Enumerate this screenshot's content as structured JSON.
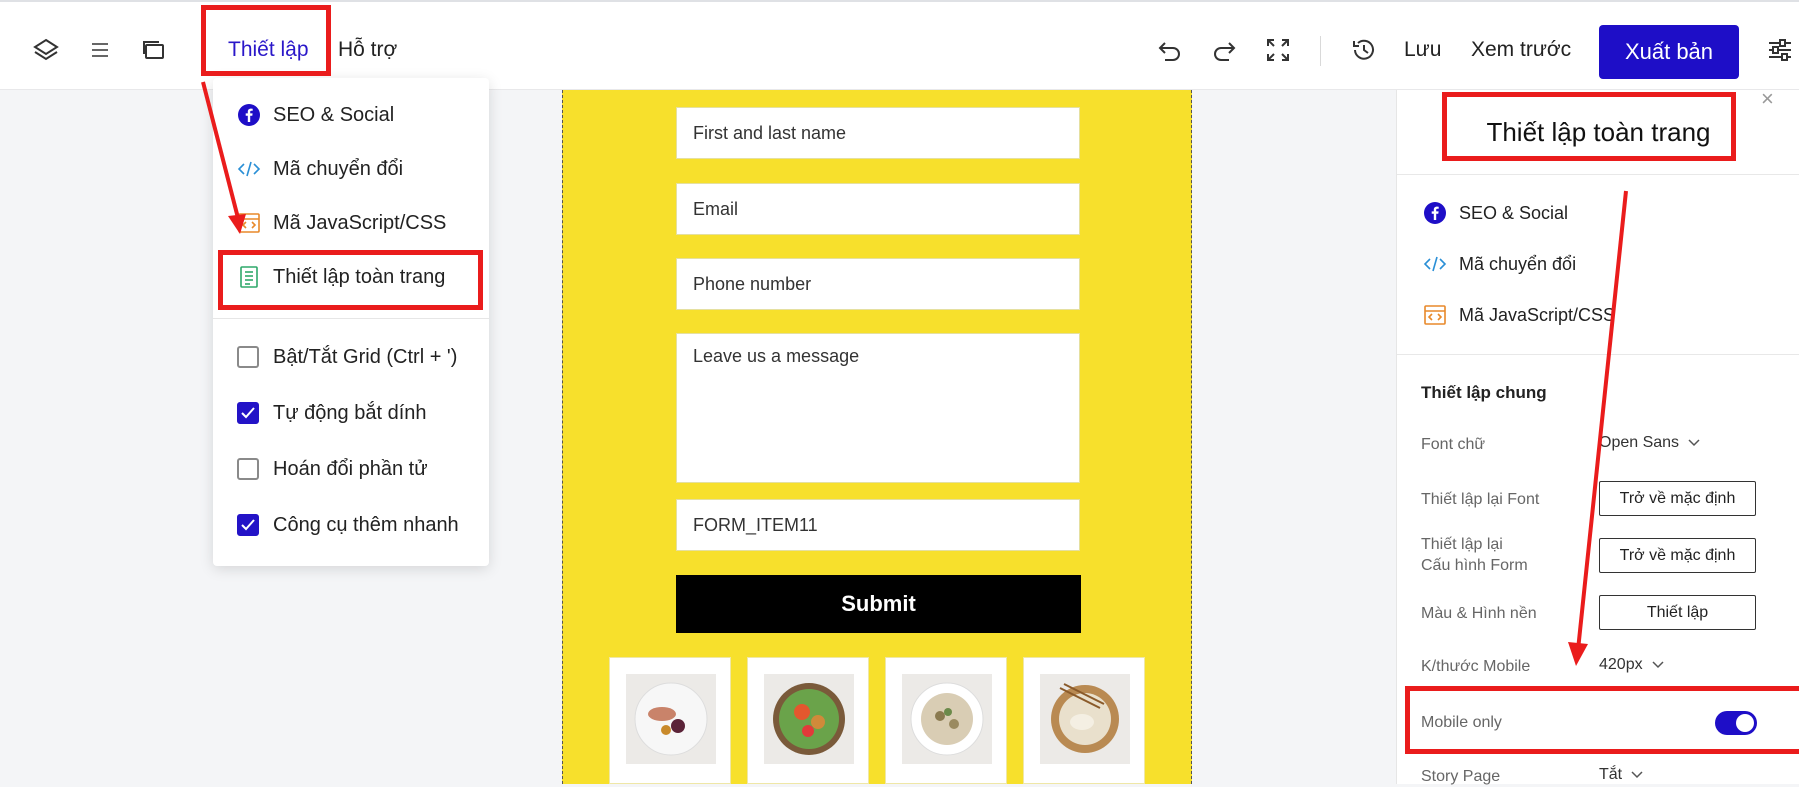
{
  "toolbar": {
    "menu_settings": "Thiết lập",
    "menu_support": "Hỗ trợ",
    "save": "Lưu",
    "preview": "Xem trước",
    "publish": "Xuất bản"
  },
  "dropdown": {
    "items": [
      {
        "label": "SEO & Social",
        "icon": "facebook-icon"
      },
      {
        "label": "Mã chuyển đổi",
        "icon": "code-icon"
      },
      {
        "label": "Mã JavaScript/CSS",
        "icon": "code-window-icon"
      },
      {
        "label": "Thiết lập toàn trang",
        "icon": "document-icon"
      }
    ],
    "checkboxes": [
      {
        "label": "Bật/Tắt Grid (Ctrl + ')",
        "checked": false
      },
      {
        "label": "Tự động bắt dính",
        "checked": true
      },
      {
        "label": "Hoán đổi phần tử",
        "checked": false
      },
      {
        "label": "Công cụ thêm nhanh",
        "checked": true
      }
    ]
  },
  "form": {
    "fields": [
      "First and last name",
      "Email",
      "Phone number",
      "Leave us a message",
      "FORM_ITEM11"
    ],
    "submit": "Submit"
  },
  "panel": {
    "title": "Thiết lập toàn trang",
    "items": [
      {
        "label": "SEO & Social",
        "icon": "facebook-icon"
      },
      {
        "label": "Mã chuyển đổi",
        "icon": "code-icon"
      },
      {
        "label": "Mã JavaScript/CSS",
        "icon": "code-window-icon"
      }
    ],
    "section_title": "Thiết lập chung",
    "font_label": "Font chữ",
    "font_value": "Open Sans",
    "reset_font_label": "Thiết lập lại Font",
    "reset_button": "Trở về mặc định",
    "reset_form_label_1": "Thiết lập lại",
    "reset_form_label_2": "Cấu hình Form",
    "reset_form_button": "Trở về mặc định",
    "bg_label": "Màu & Hình nền",
    "bg_button": "Thiết lập",
    "mobile_size_label": "K/thước Mobile",
    "mobile_size_value": "420px",
    "mobile_only_label": "Mobile only",
    "mobile_only_on": true,
    "story_label": "Story Page",
    "story_value": "Tắt"
  },
  "colors": {
    "accent": "#1e0ec7",
    "highlight": "#ea1c1c",
    "canvas": "#f7e02c"
  }
}
